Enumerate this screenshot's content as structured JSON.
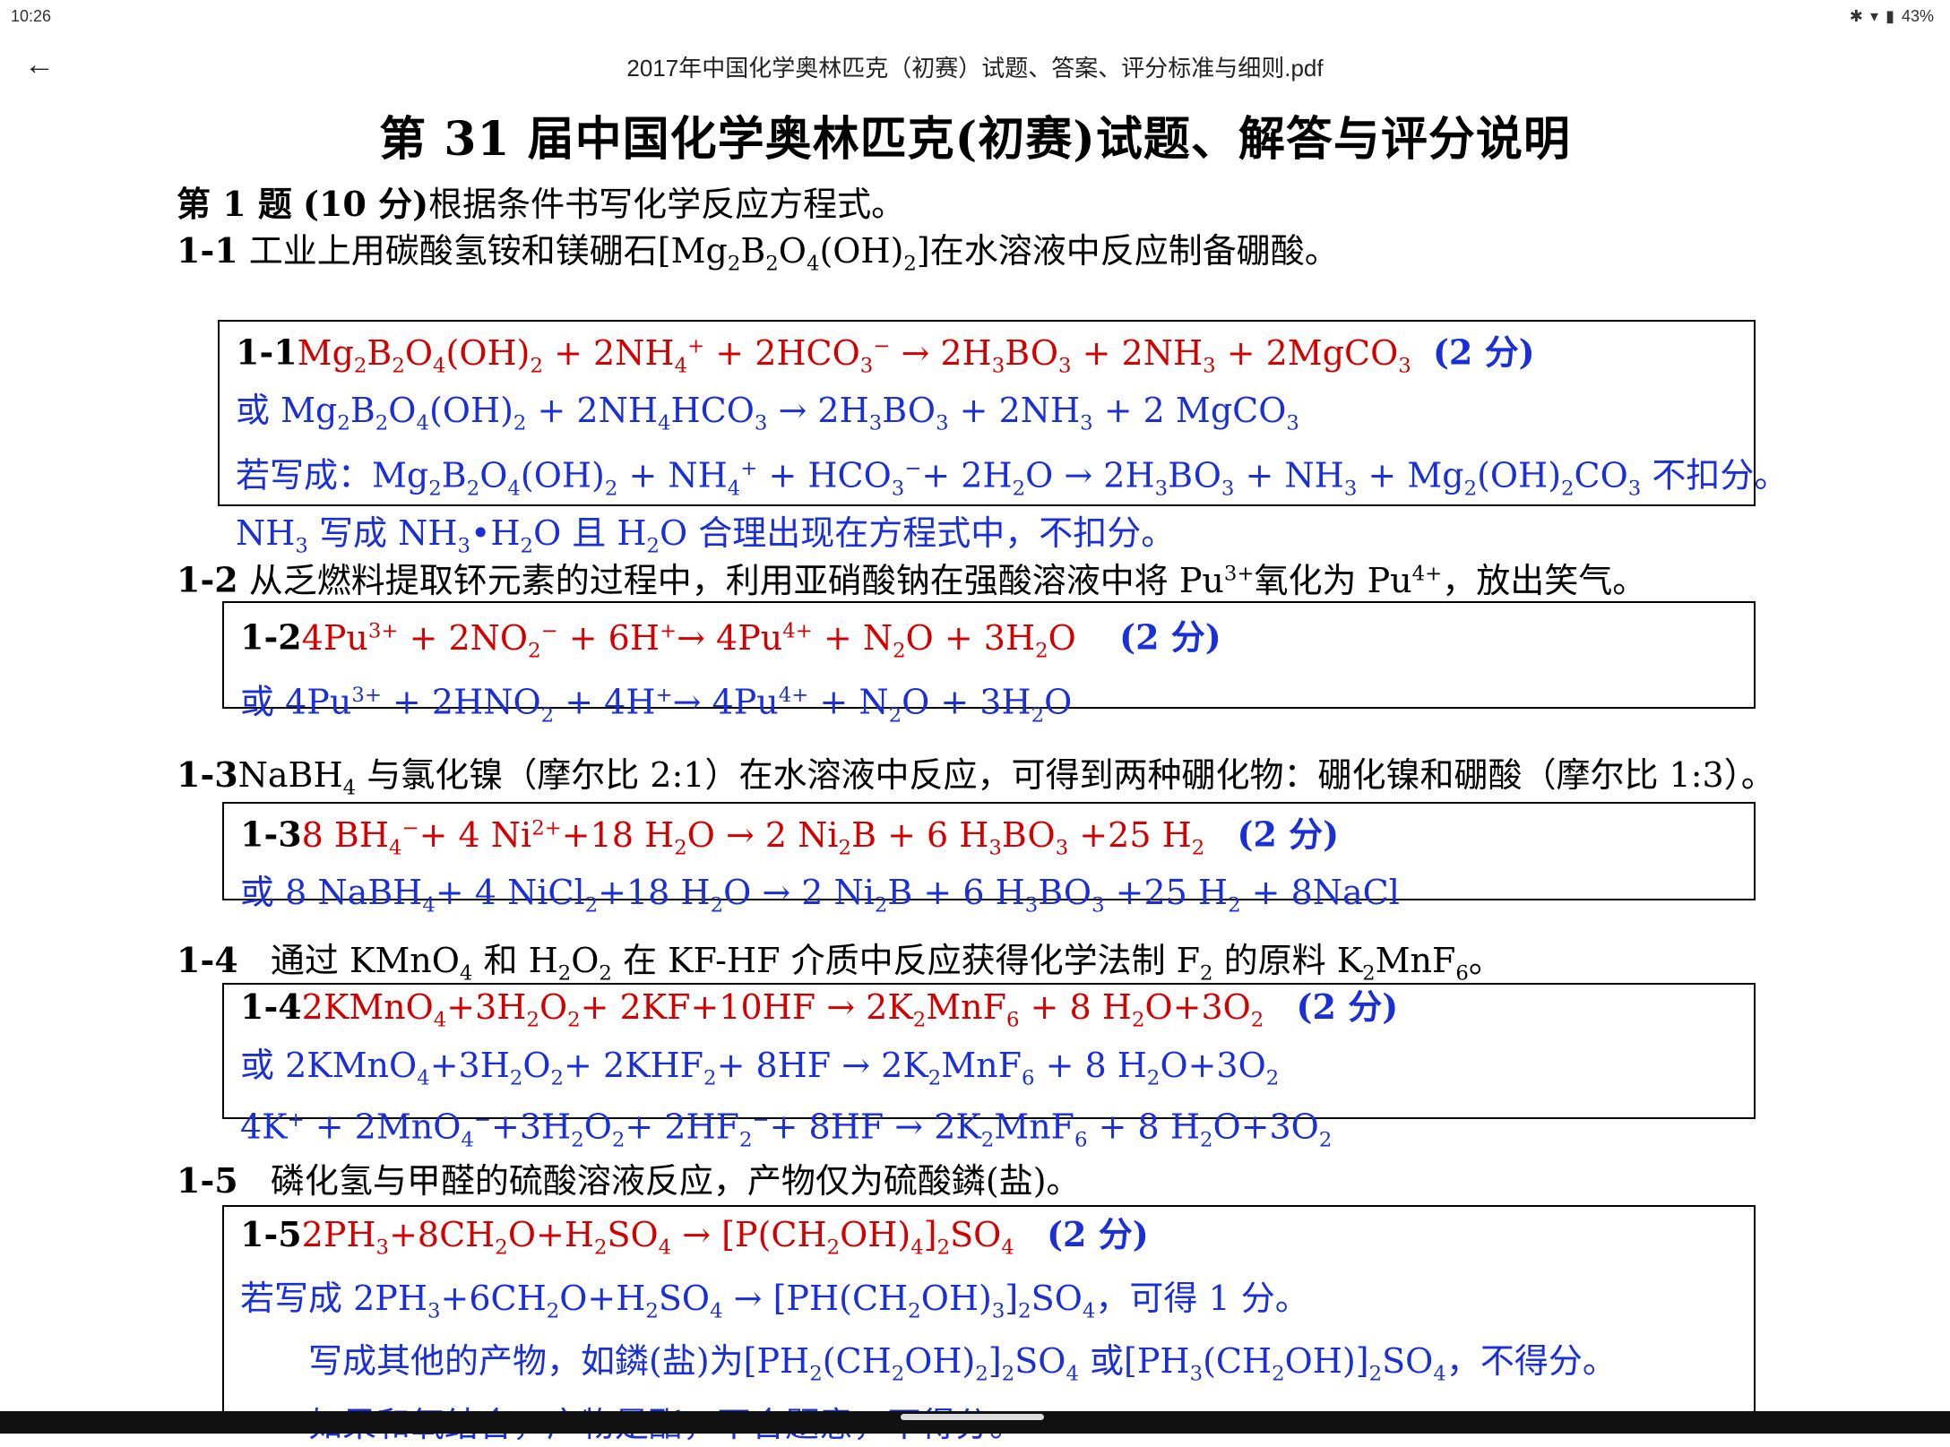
{
  "status": {
    "time": "10:26",
    "battery": "43%"
  },
  "toolbar": {
    "doc_title": "2017年中国化学奥林匹克（初赛）试题、答案、评分标准与细则.pdf"
  },
  "document": {
    "title": "第 31 届中国化学奥林匹克(初赛)试题、解答与评分说明",
    "q1_heading_num": "第 1 题",
    "q1_heading_score": "(10 分)",
    "q1_heading_text": "根据条件书写化学反应方程式。",
    "q1_1_num": "1-1",
    "q1_2_num": "1-2",
    "q1_3_num": "1-3",
    "q1_4_num": "1-4",
    "q1_5_num": "1-5",
    "score_label": "(2 分)",
    "or_label": "或",
    "q1_5_text": "磷化氢与甲醛的硫酸溶液反应，产物仅为硫酸鏻(盐)。",
    "a1_5_line4": "如果和氧结合，产物是酯，不合题意，不得分。"
  }
}
